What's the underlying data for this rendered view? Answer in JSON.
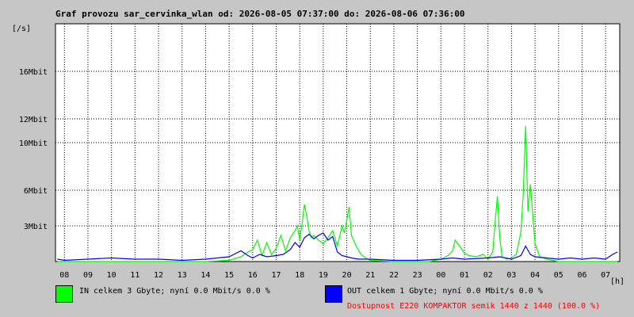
{
  "colors": {
    "in": "#00ff00",
    "out": "#0000ff",
    "availability": "#ff0000",
    "grid": "#000000"
  },
  "chart_data": {
    "type": "area",
    "title": "Graf provozu sar_cervinka_wlan od: 2026-08-05 07:37:00 do: 2026-08-06 07:36:00",
    "ylabel": "[/s]",
    "xlabel": "[h]",
    "ylim": [
      0,
      20
    ],
    "y_ticks": [
      3,
      6,
      10,
      12,
      16
    ],
    "y_tick_labels": [
      "3Mbit",
      "6Mbit",
      "10Mbit",
      "12Mbit",
      "16Mbit"
    ],
    "x_ticks": [
      8,
      9,
      10,
      11,
      12,
      13,
      14,
      15,
      16,
      17,
      18,
      19,
      20,
      21,
      22,
      23,
      24,
      25,
      26,
      27,
      28,
      29,
      30,
      31
    ],
    "x_tick_labels": [
      "08",
      "09",
      "10",
      "11",
      "12",
      "13",
      "14",
      "15",
      "16",
      "17",
      "18",
      "19",
      "20",
      "21",
      "22",
      "23",
      "00",
      "01",
      "02",
      "03",
      "04",
      "05",
      "06",
      "07"
    ],
    "xlim": [
      7.62,
      31.6
    ],
    "grid": true,
    "series": [
      {
        "name": "IN",
        "x": [
          7.7,
          9.0,
          12.0,
          14.0,
          15.0,
          15.5,
          15.8,
          16.0,
          16.2,
          16.4,
          16.6,
          16.8,
          17.0,
          17.2,
          17.4,
          17.6,
          17.8,
          17.9,
          18.0,
          18.1,
          18.2,
          18.3,
          18.4,
          18.5,
          18.6,
          18.8,
          19.0,
          19.2,
          19.4,
          19.6,
          19.8,
          19.9,
          20.0,
          20.1,
          20.2,
          20.4,
          20.6,
          20.8,
          21.0,
          22.0,
          23.0,
          23.5,
          24.0,
          24.3,
          24.5,
          24.6,
          24.8,
          25.0,
          25.2,
          25.5,
          25.8,
          26.0,
          26.2,
          26.3,
          26.4,
          26.5,
          26.6,
          26.8,
          27.0,
          27.2,
          27.4,
          27.5,
          27.6,
          27.7,
          27.8,
          28.0,
          28.2,
          28.5,
          29.0,
          30.0,
          31.0,
          31.5
        ],
        "values": [
          0,
          0,
          0,
          0,
          0.1,
          0.4,
          0.8,
          1.0,
          1.8,
          0.5,
          1.6,
          0.6,
          1.1,
          2.2,
          0.9,
          2.0,
          2.6,
          3.0,
          1.8,
          3.2,
          4.8,
          3.8,
          2.5,
          2.0,
          2.2,
          1.8,
          1.5,
          2.0,
          2.6,
          1.3,
          3.0,
          2.4,
          3.5,
          4.6,
          2.2,
          1.3,
          0.6,
          0.3,
          0.1,
          0,
          0,
          0,
          0.2,
          0.5,
          0.9,
          1.8,
          1.3,
          0.7,
          0.5,
          0.4,
          0.6,
          0.2,
          0.8,
          3.2,
          5.5,
          2.0,
          0.4,
          0.2,
          0.3,
          0.6,
          2.5,
          5.8,
          11.4,
          4.2,
          6.5,
          1.5,
          0.4,
          0.2,
          0,
          0,
          0,
          0
        ]
      },
      {
        "name": "OUT",
        "x": [
          7.7,
          8.0,
          9.0,
          10.0,
          11.0,
          12.0,
          13.0,
          14.0,
          15.0,
          15.2,
          15.5,
          15.8,
          16.0,
          16.3,
          16.6,
          17.0,
          17.3,
          17.6,
          17.8,
          18.0,
          18.2,
          18.4,
          18.6,
          18.8,
          19.0,
          19.2,
          19.4,
          19.6,
          19.8,
          20.0,
          20.2,
          20.5,
          21.0,
          22.0,
          23.0,
          24.0,
          24.5,
          25.0,
          26.0,
          26.5,
          27.0,
          27.4,
          27.6,
          27.8,
          28.0,
          28.5,
          29.0,
          29.5,
          30.0,
          30.5,
          31.0,
          31.3,
          31.5
        ],
        "values": [
          0.2,
          0.1,
          0.2,
          0.3,
          0.2,
          0.2,
          0.1,
          0.2,
          0.4,
          0.6,
          0.9,
          0.5,
          0.3,
          0.6,
          0.4,
          0.5,
          0.6,
          1.0,
          1.6,
          1.2,
          2.0,
          2.3,
          1.9,
          2.2,
          2.4,
          1.8,
          2.1,
          0.8,
          0.5,
          0.4,
          0.3,
          0.2,
          0.2,
          0.1,
          0.1,
          0.2,
          0.3,
          0.2,
          0.3,
          0.4,
          0.2,
          0.5,
          1.3,
          0.6,
          0.4,
          0.3,
          0.2,
          0.3,
          0.2,
          0.3,
          0.2,
          0.6,
          0.8
        ]
      }
    ]
  },
  "legend": {
    "in_text": "IN celkem 3 Gbyte; nyní   0.0 Mbit/s 0.0 %",
    "out_text": "OUT celkem 1 Gbyte; nyní   0.0 Mbit/s 0.0 %",
    "availability_text": "Dostupnost E220 KOMPAKTOR semik 1440 z 1440 (100.0 %)"
  }
}
